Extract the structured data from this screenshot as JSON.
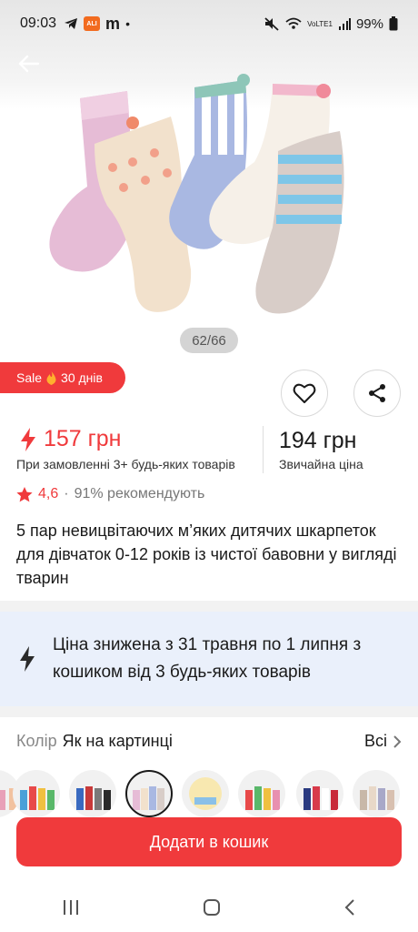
{
  "status_bar": {
    "time": "09:03",
    "battery": "99%",
    "network": "VoLTE1"
  },
  "gallery": {
    "counter": "62/66"
  },
  "sale_badge": {
    "label": "Sale",
    "duration": "30 днів"
  },
  "price": {
    "sale_value": "157 грн",
    "sale_condition": "При замовленні 3+ будь-яких товарів",
    "regular_value": "194 грн",
    "regular_label": "Звичайна ціна"
  },
  "rating": {
    "value": "4,6",
    "separator": "·",
    "recommend": "91% рекомендують"
  },
  "product": {
    "title": "5 пар невицвітаючих м’яких дитячих шкарпеток для дівчаток 0-12 років із чистої бавовни у вигляді тварин"
  },
  "promo": {
    "text": "Ціна знижена з 31 травня по 1 липня з кошиком від 3 будь-яких товарів"
  },
  "color": {
    "label": "Колір",
    "value": "Як на картинці",
    "all_label": "Всі"
  },
  "actions": {
    "add_to_cart": "Додати в кошик"
  },
  "icons": [
    "back-arrow-icon",
    "heart-icon",
    "share-icon",
    "lightning-icon",
    "star-icon",
    "chevron-right-icon",
    "recent-apps-icon",
    "home-icon",
    "back-icon"
  ],
  "colors": {
    "accent": "#f03a3c",
    "promo_bg": "#eaf0fb"
  }
}
